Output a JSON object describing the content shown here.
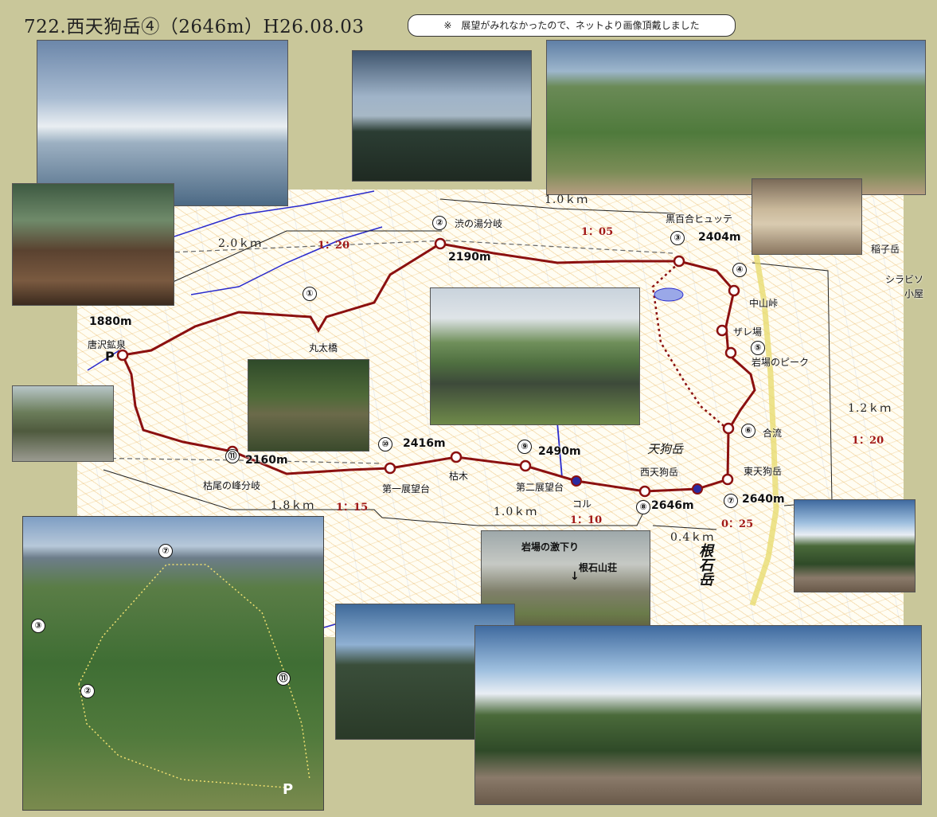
{
  "title": "722.西天狗岳④（2646m）H26.08.03",
  "note": "※　展望がみれなかったので、ネットより画像頂戴しました",
  "waypoints": {
    "w1": {
      "num": "①",
      "name": "丸太橋"
    },
    "w2": {
      "num": "②",
      "name": "渋の湯分岐",
      "elev": "2190m"
    },
    "w3": {
      "num": "③",
      "name": "黒百合ヒュッテ",
      "elev": "2404m"
    },
    "w4": {
      "num": "④",
      "name": "中山峠"
    },
    "w5": {
      "num": "⑤",
      "name": "岩場のピーク"
    },
    "zare": "ザレ場",
    "w6": {
      "num": "⑥",
      "name": "合流"
    },
    "w7": {
      "num": "⑦",
      "name": "東天狗岳",
      "elev": "2640m"
    },
    "w8": {
      "num": "⑧",
      "name": "西天狗岳",
      "elev": "2646m"
    },
    "w9": {
      "num": "⑨",
      "name": "第二展望台",
      "elev": "2490m"
    },
    "col": "コル",
    "karegi": "枯木",
    "w10": {
      "num": "⑩",
      "name": "第一展望台",
      "elev": "2416m"
    },
    "w11": {
      "num": "⑪",
      "name": "枯尾の峰分岐",
      "elev": "2160m"
    },
    "start": {
      "name": "唐沢鉱泉",
      "elev": "1880m",
      "parking": "P"
    }
  },
  "distances": {
    "d1": "2.0ｋｍ",
    "r1": "1：20",
    "d2": "1.0ｋｍ",
    "r2": "1：05",
    "d3": "1.2ｋｍ",
    "r3": "1：20",
    "d4": "0.4ｋｍ",
    "r4": "0：25",
    "d5": "1.0ｋｍ",
    "r5": "1：10",
    "d6": "1.8ｋｍ",
    "r6": "1：15"
  },
  "places": {
    "inako": "稲子岳",
    "shirabiso": "シラビソ\n小屋",
    "tengu_map": "天狗岳",
    "neishi_map": "根石岳",
    "neishi_hut_map": "根石山荘",
    "kurayuri_map": "黒百合ヒュッテ"
  },
  "photo_labels": {
    "iwaba": "岩場の激下り",
    "neishi_hut": "根石山荘"
  },
  "birdseye": {
    "labels": [
      "⑦",
      "③",
      "②",
      "⑪",
      "P"
    ]
  },
  "colors": {
    "route": "#8b1010",
    "map_bg": "#fffdf3",
    "page_bg": "#c9c79a"
  }
}
